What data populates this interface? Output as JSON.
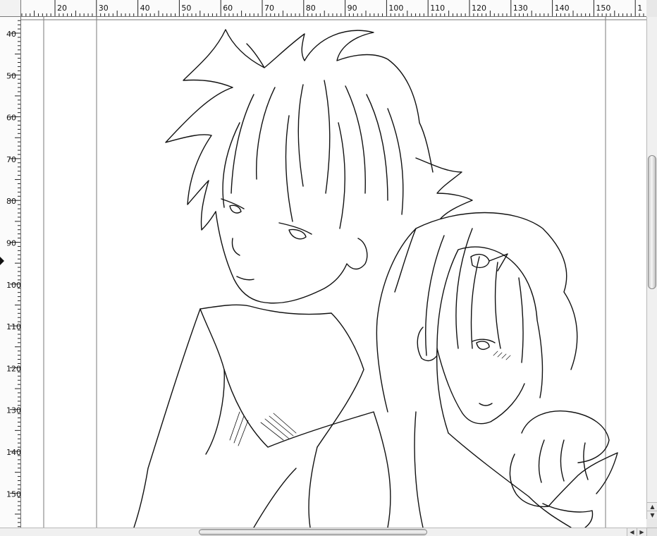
{
  "rulers": {
    "horizontal_labels": [
      "20",
      "30",
      "40",
      "50",
      "60",
      "70",
      "80",
      "90",
      "100",
      "110",
      "120",
      "130",
      "140",
      "150",
      "1"
    ],
    "vertical_labels": [
      "40",
      "50",
      "60",
      "70",
      "80",
      "90",
      "100",
      "110",
      "120",
      "130",
      "140",
      "150"
    ],
    "unit": "mm"
  },
  "artwork": {
    "style": "black line art on white",
    "subject": "two manga-style characters: spiky-haired young man in high-collar coat, girl with ponytail and hair ornament holding a round object"
  },
  "scrollbars": {
    "up_glyph": "▲",
    "down_glyph": "▼",
    "left_glyph": "◀",
    "right_glyph": "▶"
  },
  "colors": {
    "ruler_bg": "#fbfbfb",
    "canvas_bg": "#ffffff",
    "guide_line": "#808080",
    "ink": "#111111"
  }
}
